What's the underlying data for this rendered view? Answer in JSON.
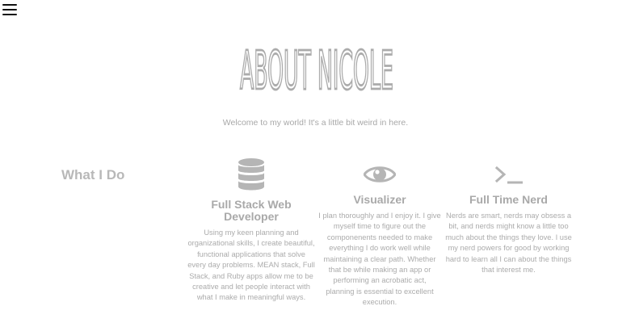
{
  "nav": {
    "menu_icon": "hamburger-menu-icon"
  },
  "hero": {
    "title": "ABOUT NICOLE",
    "tagline": "Welcome to my world! It's a little bit weird in here."
  },
  "what_i_do": {
    "heading": "What I Do",
    "items": [
      {
        "icon": "database-icon",
        "title": "Full Stack Web Developer",
        "description": "Using my keen planning and organizational skills, I create beautiful, functional applications that solve every day problems. MEAN stack, Full Stack, and Ruby apps allow me to be creative and let people interact with what I make in meaningful ways."
      },
      {
        "icon": "eye-icon",
        "title": "Visualizer",
        "description": "I plan thoroughly and I enjoy it. I give myself time to figure out the componenents needed to make everything I do work well while maintaining a clear path. Whether that be while making an app or performing an acrobatic act, planning is essential to excellent execution."
      },
      {
        "icon": "terminal-icon",
        "title": "Full Time Nerd",
        "description": "Nerds are smart, nerds may obsess a bit, and nerds might know a little too much about the things they love. I use my nerd powers for good by working hard to learn all I can about the things that interest me."
      }
    ]
  },
  "colors": {
    "text": "#b3b3b3",
    "icon": "#b5b5b5",
    "menu": "#111111",
    "background": "#ffffff"
  }
}
